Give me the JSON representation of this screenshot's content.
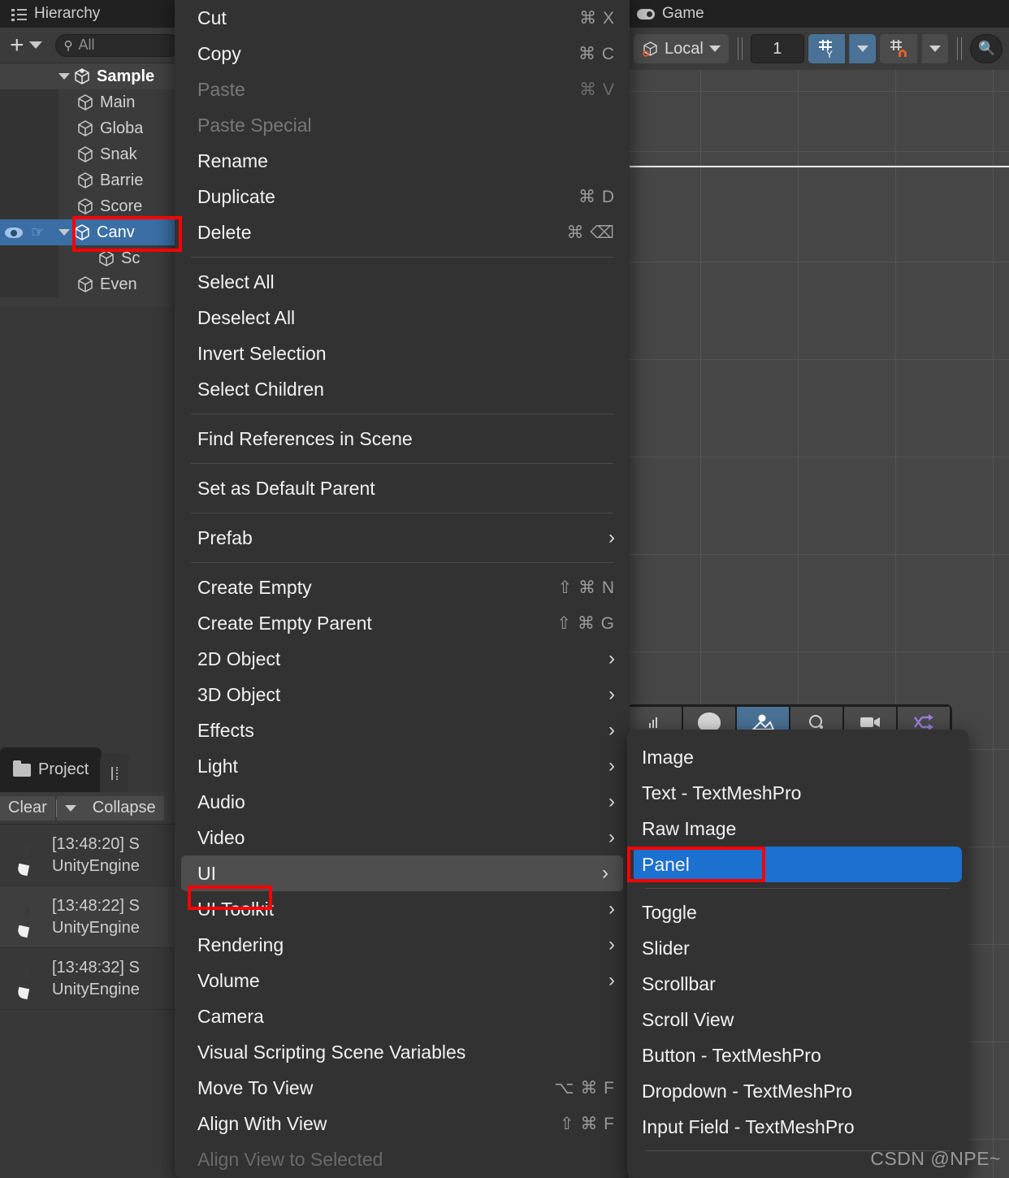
{
  "hierarchy": {
    "tab_label": "Hierarchy",
    "search_placeholder": "All",
    "items": [
      {
        "label": "Sample",
        "indent": 0,
        "root": true,
        "expanded": true
      },
      {
        "label": "Main",
        "indent": 1
      },
      {
        "label": "Globa",
        "indent": 1
      },
      {
        "label": "Snak",
        "indent": 1
      },
      {
        "label": "Barrie",
        "indent": 1
      },
      {
        "label": "Score",
        "indent": 1
      },
      {
        "label": "Canv",
        "indent": 1,
        "selected": true,
        "expanded": true
      },
      {
        "label": "Sc",
        "indent": 2
      },
      {
        "label": "Even",
        "indent": 1
      }
    ]
  },
  "project": {
    "tab_label": "Project",
    "toolbar": {
      "clear_label": "Clear",
      "collapse_label": "Collapse"
    },
    "logs": [
      {
        "time": "[13:48:20]",
        "head": "[13:48:20] S",
        "body": "UnityEngine"
      },
      {
        "time": "[13:48:22]",
        "head": "[13:48:22] S",
        "body": "UnityEngine"
      },
      {
        "time": "[13:48:32]",
        "head": "[13:48:32] S",
        "body": "UnityEngine"
      }
    ]
  },
  "game": {
    "tab_label": "Game",
    "toolbar": {
      "pivot_label": "Local",
      "snap_value": "1"
    }
  },
  "context_menu": {
    "items": [
      {
        "label": "Cut",
        "shortcut": "⌘ X"
      },
      {
        "label": "Copy",
        "shortcut": "⌘ C"
      },
      {
        "label": "Paste",
        "shortcut": "⌘ V",
        "disabled": true
      },
      {
        "label": "Paste Special",
        "shortcut": "",
        "disabled": true
      },
      {
        "label": "Rename",
        "shortcut": ""
      },
      {
        "label": "Duplicate",
        "shortcut": "⌘ D"
      },
      {
        "label": "Delete",
        "shortcut": "⌘ ⌫"
      },
      {
        "separator": true
      },
      {
        "label": "Select All",
        "shortcut": ""
      },
      {
        "label": "Deselect All",
        "shortcut": ""
      },
      {
        "label": "Invert Selection",
        "shortcut": ""
      },
      {
        "label": "Select Children",
        "shortcut": ""
      },
      {
        "separator": true
      },
      {
        "label": "Find References in Scene",
        "shortcut": ""
      },
      {
        "separator": true
      },
      {
        "label": "Set as Default Parent",
        "shortcut": ""
      },
      {
        "separator": true
      },
      {
        "label": "Prefab",
        "submenu": true
      },
      {
        "separator": true
      },
      {
        "label": "Create Empty",
        "shortcut": "⇧ ⌘ N"
      },
      {
        "label": "Create Empty Parent",
        "shortcut": "⇧ ⌘ G"
      },
      {
        "label": "2D Object",
        "submenu": true
      },
      {
        "label": "3D Object",
        "submenu": true
      },
      {
        "label": "Effects",
        "submenu": true
      },
      {
        "label": "Light",
        "submenu": true
      },
      {
        "label": "Audio",
        "submenu": true
      },
      {
        "label": "Video",
        "submenu": true
      },
      {
        "label": "UI",
        "submenu": true,
        "highlighted": true
      },
      {
        "label": "UI Toolkit",
        "submenu": true
      },
      {
        "label": "Rendering",
        "submenu": true
      },
      {
        "label": "Volume",
        "submenu": true
      },
      {
        "label": "Camera",
        "shortcut": ""
      },
      {
        "label": "Visual Scripting Scene Variables",
        "shortcut": ""
      },
      {
        "label": "Move To View",
        "shortcut": "⌥ ⌘ F"
      },
      {
        "label": "Align With View",
        "shortcut": "⇧ ⌘ F"
      },
      {
        "label": "Align View to Selected",
        "shortcut": "",
        "clipped": true
      }
    ]
  },
  "sub_menu": {
    "items": [
      {
        "label": "Image"
      },
      {
        "label": "Text - TextMeshPro"
      },
      {
        "label": "Raw Image"
      },
      {
        "label": "Panel",
        "selected": true
      },
      {
        "separator": true
      },
      {
        "label": "Toggle"
      },
      {
        "label": "Slider"
      },
      {
        "label": "Scrollbar"
      },
      {
        "label": "Scroll View"
      },
      {
        "label": "Button - TextMeshPro"
      },
      {
        "label": "Dropdown - TextMeshPro"
      },
      {
        "label": "Input Field - TextMeshPro"
      },
      {
        "separator": true
      }
    ]
  },
  "watermark": "CSDN @NPE~",
  "colors": {
    "selection_blue": "#1b70d0",
    "hierarchy_selected": "#3a6ea5",
    "annotation_red": "#ff0000",
    "toolbar_active": "#4a7296"
  }
}
